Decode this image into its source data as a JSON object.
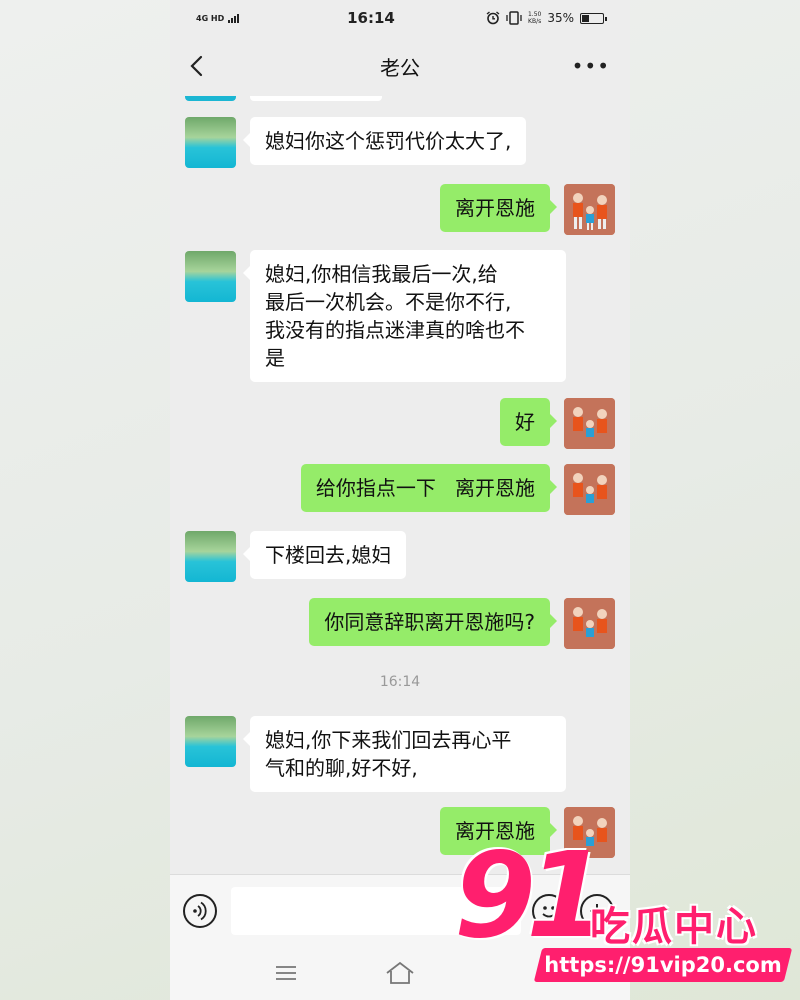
{
  "status_bar": {
    "network": "4G HD",
    "time": "16:14",
    "speed_value": "1.50",
    "speed_unit": "KB/s",
    "battery": "35%",
    "battery_level_percent": 35
  },
  "header": {
    "title": "老公",
    "back_icon": "chevron-left-icon",
    "more_icon": "more-dots-icon"
  },
  "messages": [
    {
      "side": "in",
      "text": "媳妇你这个惩罚代价太大了,"
    },
    {
      "side": "out",
      "text": "离开恩施"
    },
    {
      "side": "in",
      "text": "媳妇,你相信我最后一次,给\n最后一次机会。不是你不行,\n我没有的指点迷津真的啥也不\n是"
    },
    {
      "side": "out",
      "text": "好"
    },
    {
      "side": "out",
      "text": "给你指点一下   离开恩施"
    },
    {
      "side": "in",
      "text": "下楼回去,媳妇"
    },
    {
      "side": "out",
      "text": "你同意辞职离开恩施吗?"
    },
    {
      "side": "in",
      "text": "媳妇,你下来我们回去再心平\n气和的聊,好不好,"
    },
    {
      "side": "out",
      "text": "离开恩施"
    }
  ],
  "chat_timestamp": "16:14",
  "input_bar": {
    "voice_icon": "voice-icon",
    "text_value": "",
    "emoji_icon": "emoji-icon",
    "plus_icon": "plus-icon"
  },
  "nav_bar": {
    "menu_icon": "menu-icon",
    "home_icon": "home-icon"
  },
  "watermark": {
    "number": "91",
    "text": "吃瓜中心",
    "url": "https://91vip20.com"
  },
  "colors": {
    "incoming_bubble": "#ffffff",
    "outgoing_bubble": "#95ec69",
    "chat_background": "#ededed",
    "watermark": "#ff1f6e"
  }
}
